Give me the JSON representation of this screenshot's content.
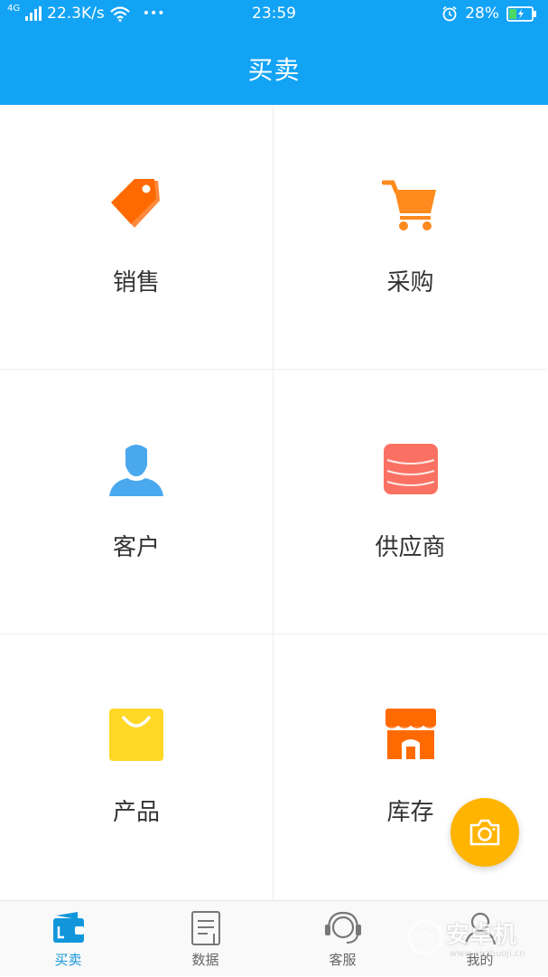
{
  "status_bar": {
    "network": "4G",
    "speed": "22.3K/s",
    "more": "•••",
    "time": "23:59",
    "battery": "28%"
  },
  "header": {
    "title": "买卖"
  },
  "grid": [
    {
      "label": "销售",
      "icon": "price-tag-icon",
      "color": "#FF6A00"
    },
    {
      "label": "采购",
      "icon": "shopping-cart-icon",
      "color": "#FF8A1E"
    },
    {
      "label": "客户",
      "icon": "user-icon",
      "color": "#4AA8EE"
    },
    {
      "label": "供应商",
      "icon": "database-icon",
      "color": "#FA7163"
    },
    {
      "label": "产品",
      "icon": "shopping-bag-icon",
      "color": "#FFD826"
    },
    {
      "label": "库存",
      "icon": "store-icon",
      "color": "#FF6A00"
    }
  ],
  "fab": {
    "icon": "camera-icon",
    "color": "#FFB400"
  },
  "bottom_nav": [
    {
      "label": "买卖",
      "icon": "wallet-icon",
      "active": true
    },
    {
      "label": "数据",
      "icon": "document-icon",
      "active": false
    },
    {
      "label": "客服",
      "icon": "headset-icon",
      "active": false
    },
    {
      "label": "我的",
      "icon": "user-outline-icon",
      "active": false
    }
  ],
  "watermark": {
    "text": "安卓机",
    "subtext": "www.anzhuoji.cn"
  },
  "colors": {
    "header": "#12A3F5",
    "active_nav": "#1296DB"
  }
}
